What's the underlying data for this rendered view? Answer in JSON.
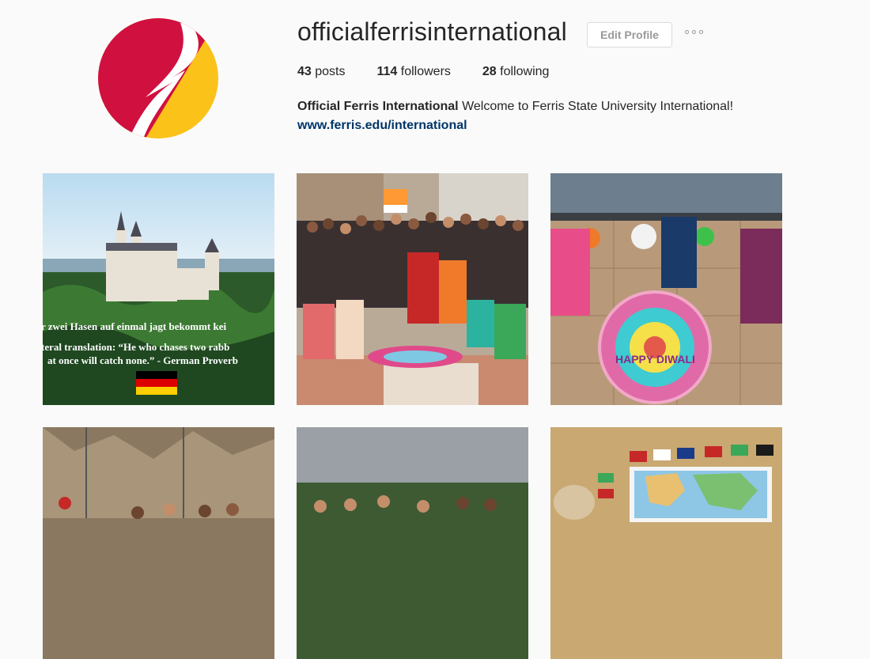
{
  "profile": {
    "username": "officialferrisinternational",
    "edit_label": "Edit Profile",
    "stats": {
      "posts_count": "43",
      "posts_label": "posts",
      "followers_count": "114",
      "followers_label": "followers",
      "following_count": "28",
      "following_label": "following"
    },
    "bio": {
      "full_name": "Official Ferris International",
      "text": "Welcome to Ferris State University International!",
      "link": "www.ferris.edu/international"
    }
  },
  "colors": {
    "logo_red": "#d0103f",
    "logo_yellow": "#fbc21a",
    "link": "#003569"
  },
  "icons": {
    "more": "more-options-icon"
  },
  "posts": [
    {
      "id": "castle",
      "quote_line1": "r zwei Hasen auf einmal jagt bekommt kei",
      "quote_line2": "teral translation: “He who chases two rabb",
      "quote_line3": "at once will catch none.” - German Proverb"
    },
    {
      "id": "group-photo"
    },
    {
      "id": "diwali-rangoli",
      "rangoli_text": "HAPPY DIWALI"
    },
    {
      "id": "climbing-wall"
    },
    {
      "id": "outdoor-group"
    },
    {
      "id": "world-map"
    }
  ]
}
